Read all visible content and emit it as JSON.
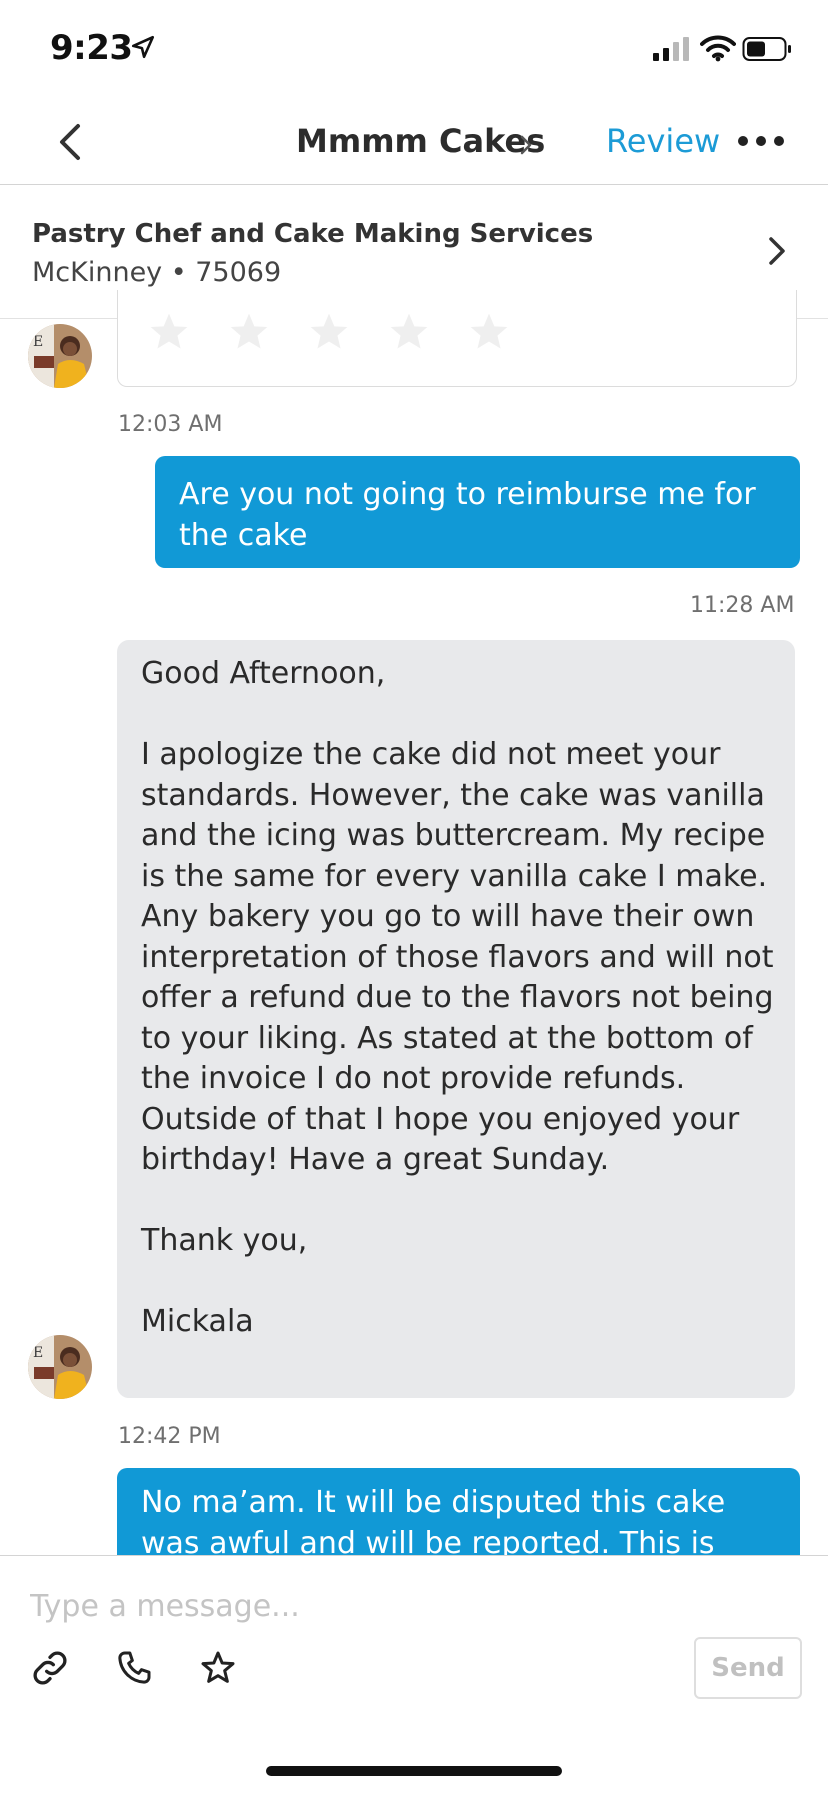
{
  "status_bar": {
    "time": "9:23",
    "icons": [
      "location-arrow-icon",
      "signal-icon",
      "wifi-icon",
      "battery-icon"
    ]
  },
  "nav": {
    "title": "Mmmm Cakes",
    "title_chevron": ">",
    "review": "Review"
  },
  "business": {
    "name": "Pastry Chef and Cake Making Services",
    "location": "McKinney • 75069"
  },
  "rating_card": {
    "stars": 5,
    "filled": 0
  },
  "messages": [
    {
      "timestamp": "12:03 AM"
    },
    {
      "direction": "outgoing",
      "text": "Are you not going to reimburse me for the cake",
      "timestamp": "11:28 AM"
    },
    {
      "direction": "incoming",
      "paragraphs": [
        "Good Afternoon,",
        "I apologize the cake did not meet your standards. However, the cake was vanilla and the icing was buttercream. My recipe is the same for every vanilla cake I make. Any bakery you go to will have their own interpretation of those flavors and will not offer a refund due to the flavors not being to your liking. As stated at the bottom of the invoice I do not provide refunds. Outside of that I hope you enjoyed your birthday! Have a great Sunday.",
        "Thank you,",
        "Mickala"
      ],
      "timestamp": "12:42 PM"
    },
    {
      "direction": "outgoing",
      "text": "No ma’am. It will be disputed this cake was awful and will be reported. This is"
    }
  ],
  "compose": {
    "placeholder": "Type a message...",
    "tools": [
      "link-icon",
      "phone-icon",
      "star-icon"
    ],
    "send": "Send"
  },
  "colors": {
    "accent": "#1199d6",
    "link": "#1c9bd6",
    "incoming_bubble": "#e8e9eb"
  }
}
